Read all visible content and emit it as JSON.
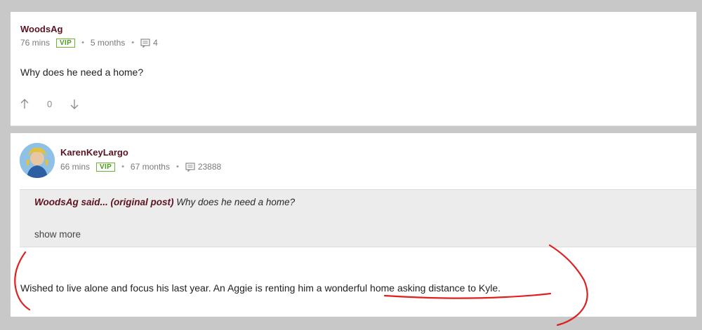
{
  "post1": {
    "username": "WoodsAg",
    "mins": "76 mins",
    "vip": "VIP",
    "age": "5 months",
    "reply_count": "4",
    "body": "Why does he need a home?",
    "vote_count": "0"
  },
  "post2": {
    "username": "KarenKeyLargo",
    "mins": "66 mins",
    "vip": "VIP",
    "age": "67 months",
    "reply_count": "23888",
    "quote": {
      "author": "WoodsAg said...",
      "source": "(original post)",
      "text": "Why does he need a home?",
      "show_more": "show more"
    },
    "body": "Wished to live alone and focus his last year. An Aggie is renting him a wonderful home asking distance to Kyle."
  },
  "colors": {
    "username": "#5c1220",
    "vip_green": "#4a9a1f",
    "annotation_red": "#e02020",
    "backdrop": "#c8c8c8"
  },
  "icons": [
    "comments-icon",
    "upvote-icon",
    "downvote-icon"
  ]
}
